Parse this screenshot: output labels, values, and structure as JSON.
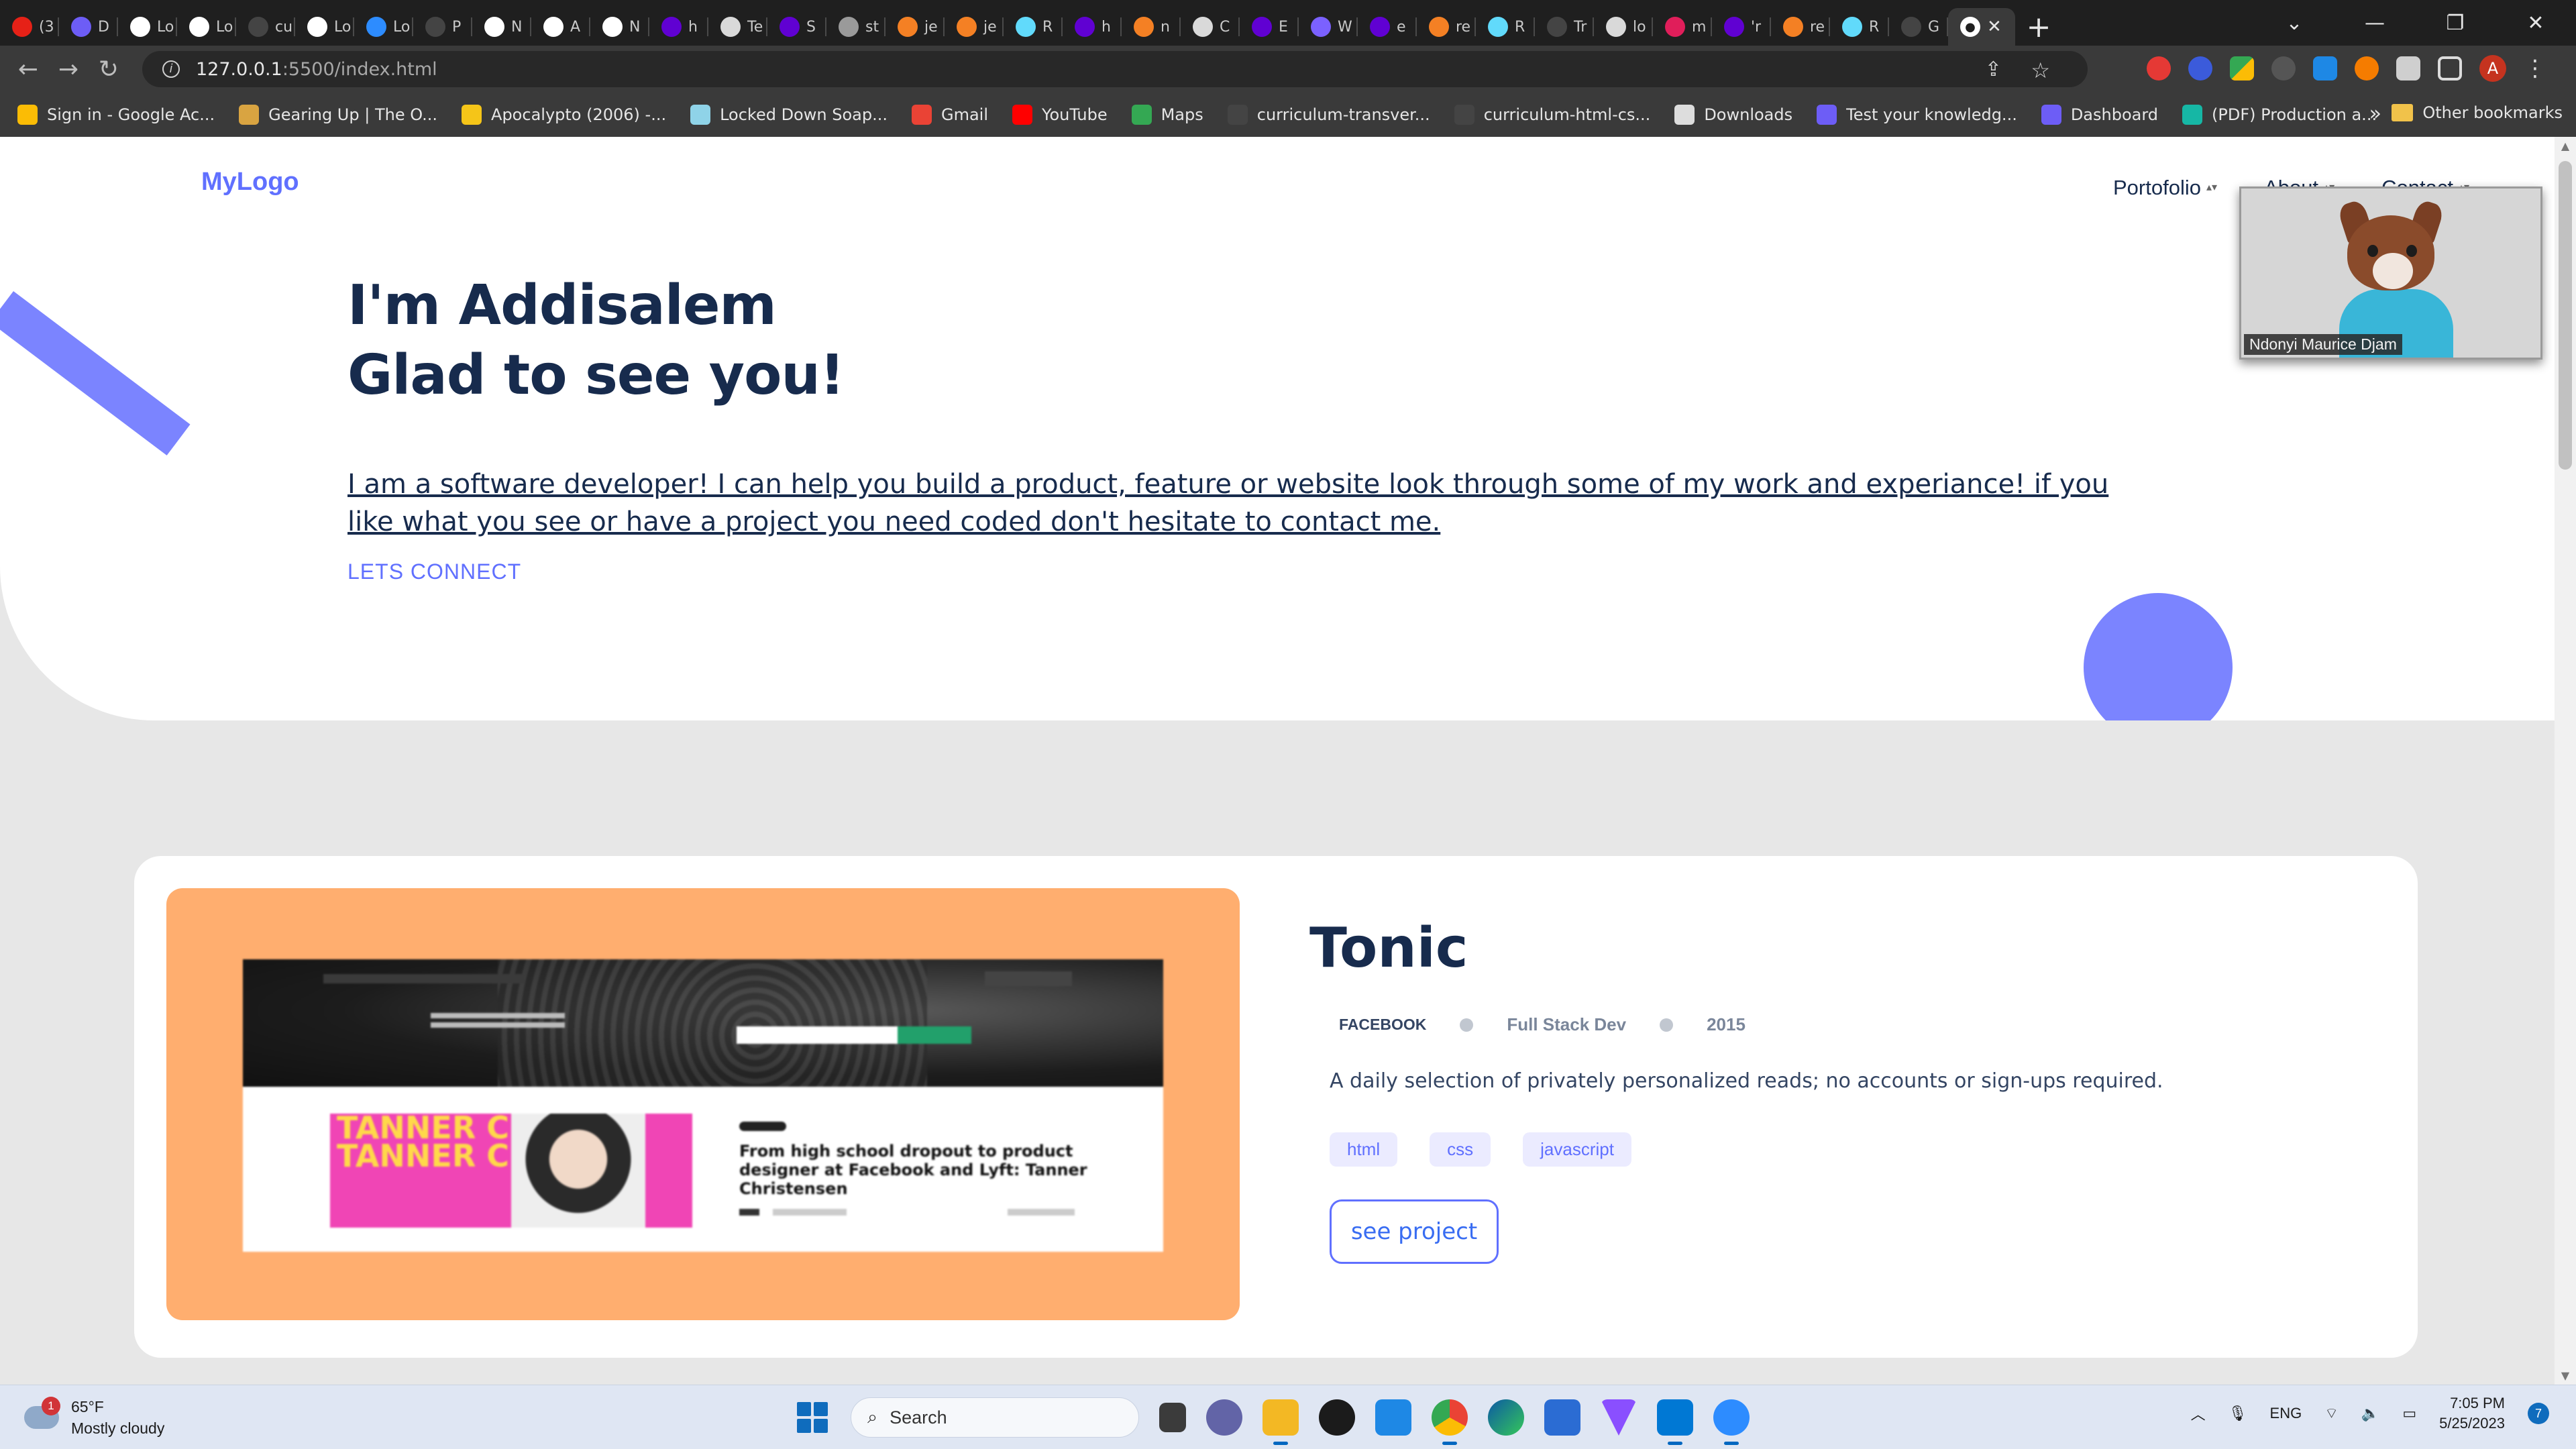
{
  "browser": {
    "tabs": [
      {
        "label": "(3",
        "icon": "youtube-icon",
        "color": "#e62117"
      },
      {
        "label": "D",
        "icon": "dashboard-icon",
        "color": "#6d5df6"
      },
      {
        "label": "Lo",
        "icon": "site-icon",
        "color": "#ffffff"
      },
      {
        "label": "Lo",
        "icon": "site-icon",
        "color": "#ffffff"
      },
      {
        "label": "cu",
        "icon": "github-icon",
        "color": "#444444"
      },
      {
        "label": "Lo",
        "icon": "site-icon",
        "color": "#ffffff"
      },
      {
        "label": "Lo",
        "icon": "zoom-icon",
        "color": "#2d8cff"
      },
      {
        "label": "P",
        "icon": "github-icon",
        "color": "#444444"
      },
      {
        "label": "N",
        "icon": "site-icon",
        "color": "#ffffff"
      },
      {
        "label": "A",
        "icon": "site-icon",
        "color": "#ffffff"
      },
      {
        "label": "N",
        "icon": "site-icon",
        "color": "#ffffff"
      },
      {
        "label": "h",
        "icon": "yahoo-icon",
        "color": "#6001d2"
      },
      {
        "label": "Te",
        "icon": "site-icon",
        "color": "#d9d9d9"
      },
      {
        "label": "S",
        "icon": "yahoo-icon",
        "color": "#6001d2"
      },
      {
        "label": "st",
        "icon": "site-icon",
        "color": "#9a9a9a"
      },
      {
        "label": "je",
        "icon": "stackoverflow-icon",
        "color": "#f48024"
      },
      {
        "label": "je",
        "icon": "stackoverflow-icon",
        "color": "#f48024"
      },
      {
        "label": "R",
        "icon": "react-icon",
        "color": "#61dafb"
      },
      {
        "label": "h",
        "icon": "yahoo-icon",
        "color": "#6001d2"
      },
      {
        "label": "n",
        "icon": "stackoverflow-icon",
        "color": "#f48024"
      },
      {
        "label": "C",
        "icon": "site-icon",
        "color": "#d9d9d9"
      },
      {
        "label": "E",
        "icon": "yahoo-icon",
        "color": "#6001d2"
      },
      {
        "label": "W",
        "icon": "site-icon",
        "color": "#7b61ff"
      },
      {
        "label": "e",
        "icon": "yahoo-icon",
        "color": "#6001d2"
      },
      {
        "label": "re",
        "icon": "stackoverflow-icon",
        "color": "#f48024"
      },
      {
        "label": "R",
        "icon": "react-icon",
        "color": "#61dafb"
      },
      {
        "label": "Tr",
        "icon": "github-icon",
        "color": "#444444"
      },
      {
        "label": "lo",
        "icon": "site-icon",
        "color": "#d9d9d9"
      },
      {
        "label": "m",
        "icon": "slack-icon",
        "color": "#e01e5a"
      },
      {
        "label": "'r",
        "icon": "yahoo-icon",
        "color": "#6001d2"
      },
      {
        "label": "re",
        "icon": "stackoverflow-icon",
        "color": "#f48024"
      },
      {
        "label": "R",
        "icon": "react-icon",
        "color": "#61dafb"
      },
      {
        "label": "G",
        "icon": "github-icon",
        "color": "#444444"
      }
    ],
    "active_tab_icon": "site-icon",
    "url_host": "127.0.0.1",
    "url_rest": ":5500/index.html",
    "bookmarks": [
      {
        "label": "Sign in - Google Ac...",
        "color": "#fbbc05"
      },
      {
        "label": "Gearing Up | The O...",
        "color": "#d9a441"
      },
      {
        "label": "Apocalypto (2006) -...",
        "color": "#f5c518"
      },
      {
        "label": "Locked Down Soap...",
        "color": "#8fd3e8"
      },
      {
        "label": "Gmail",
        "color": "#ea4335"
      },
      {
        "label": "YouTube",
        "color": "#ff0000"
      },
      {
        "label": "Maps",
        "color": "#34a853"
      },
      {
        "label": "curriculum-transver...",
        "color": "#444444"
      },
      {
        "label": "curriculum-html-cs...",
        "color": "#444444"
      },
      {
        "label": "Downloads",
        "color": "#dddddd"
      },
      {
        "label": "Test your knowledg...",
        "color": "#6d5df6"
      },
      {
        "label": "Dashboard",
        "color": "#6d5df6"
      },
      {
        "label": "(PDF) Production a...",
        "color": "#16b7a5"
      }
    ],
    "bookmarks_more": "»",
    "other_bookmarks": "Other bookmarks",
    "profile_initial": "A"
  },
  "page": {
    "logo": "MyLogo",
    "nav": [
      "Portofolio",
      "About",
      "Contact"
    ],
    "headline_1": "I'm Addisalem",
    "headline_2": "Glad to see you!",
    "intro": "I am a software developer! I can help you build a product, feature or website look through some of my work and experiance! if you like what you see or have a project you need coded don't hesitate to contact me.",
    "connect": "LETS CONNECT",
    "accent": "#6070ff",
    "project": {
      "title": "Tonic",
      "client": "FACEBOOK",
      "role": "Full Stack Dev",
      "year": "2015",
      "description": "A daily selection of privately personalized reads; no accounts or sign-ups required.",
      "tags": [
        "html",
        "css",
        "javascript"
      ],
      "button": "see project",
      "thumb_title": "From high school dropout to product designer at Facebook and Lyft: Tanner Christensen",
      "thumb_name": "TANNER CHRIS TANNER CHRIS"
    }
  },
  "video_call": {
    "participant": "Ndonyi Maurice Djam"
  },
  "taskbar": {
    "weather_temp": "65°F",
    "weather_desc": "Mostly cloudy",
    "weather_badge": "1",
    "search_label": "Search",
    "language": "ENG",
    "time": "7:05 PM",
    "date": "5/25/2023",
    "notifications": "7"
  }
}
